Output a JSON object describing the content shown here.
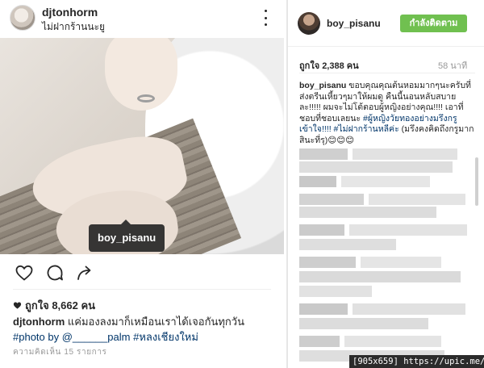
{
  "post": {
    "username": "djtonhorm",
    "location": "ไม่ฝากร้านนะยู",
    "tagged_user": "boy_pisanu",
    "likes_text": "ถูกใจ 8,662 คน",
    "caption": {
      "username": "djtonhorm",
      "text": " แค่มองลงมาก็เหมือนเราได้เจอกันทุกวัน",
      "hashtag1": "#photo",
      "by_text": " by @______palm ",
      "hashtag2": "#หลงเชียงใหม่"
    },
    "time_ago": "ความคิดเห็น 15 รายการ"
  },
  "sidebar": {
    "username": "boy_pisanu",
    "follow_label": "กำลังติดตาม",
    "likes_text": "ถูกใจ 2,388 คน",
    "time_ago": "58 นาที",
    "comment": {
      "username": "boy_pisanu",
      "text": " ขอบคุณคุณต้นหอมมากๆนะครับที่ส่งตรีนเหี้ยวๆมาให้ผมดู คืนนี้นอนหลับสบายละ!!!!! ผมจะไม่โต้ตอบผู้หญิงอย่างคุณ!!!! เอาที่ชอบที่ชอบเลยนะ ",
      "hashtag1": "#ผู้หญิงวัยทองอย่างมรึงกรูเข้าใจ!!!!",
      "hashtag2": " #ไม่ฝากร้านหลีค่ะ",
      "tail": " (มรึงคงคิดถึงกรูมากสินะที่รุ)😊😊😊"
    }
  },
  "watermark": "[905x659] https://upic.me/",
  "colors": {
    "follow_green": "#70c050",
    "hashtag_blue": "#003569",
    "text_dark": "#262626",
    "muted": "#999999"
  },
  "icons": [
    "more-dots-icon",
    "user-tag-icon",
    "heart-icon",
    "comment-icon",
    "share-icon",
    "heart-filled-icon"
  ]
}
